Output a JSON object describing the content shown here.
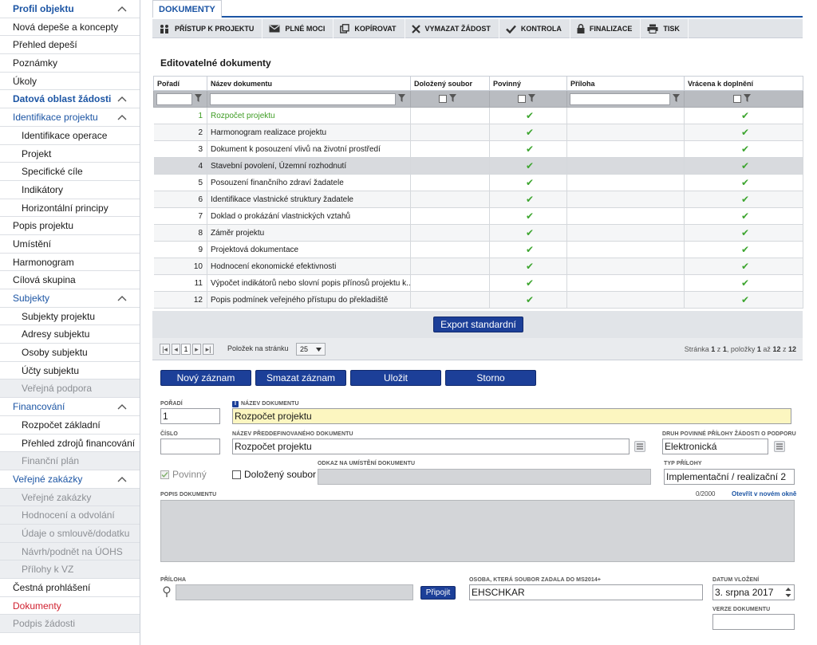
{
  "sidebar": {
    "items": [
      {
        "label": "Profil objektu",
        "kind": "sect"
      },
      {
        "label": "Nová depeše a koncepty",
        "kind": "item"
      },
      {
        "label": "Přehled depeší",
        "kind": "item"
      },
      {
        "label": "Poznámky",
        "kind": "item"
      },
      {
        "label": "Úkoly",
        "kind": "item"
      },
      {
        "label": "Datová oblast žádosti",
        "kind": "sect"
      },
      {
        "label": "Identifikace projektu",
        "kind": "selsect"
      },
      {
        "label": "Identifikace operace",
        "kind": "sub"
      },
      {
        "label": "Projekt",
        "kind": "sub"
      },
      {
        "label": "Specifické cíle",
        "kind": "sub"
      },
      {
        "label": "Indikátory",
        "kind": "sub"
      },
      {
        "label": "Horizontální principy",
        "kind": "sub"
      },
      {
        "label": "Popis projektu",
        "kind": "item"
      },
      {
        "label": "Umístění",
        "kind": "item"
      },
      {
        "label": "Harmonogram",
        "kind": "item"
      },
      {
        "label": "Cílová skupina",
        "kind": "item"
      },
      {
        "label": "Subjekty",
        "kind": "selsect"
      },
      {
        "label": "Subjekty projektu",
        "kind": "sub"
      },
      {
        "label": "Adresy subjektu",
        "kind": "sub"
      },
      {
        "label": "Osoby subjektu",
        "kind": "sub"
      },
      {
        "label": "Účty subjektu",
        "kind": "sub"
      },
      {
        "label": "Veřejná podpora",
        "kind": "subdis"
      },
      {
        "label": "Financování",
        "kind": "selsect"
      },
      {
        "label": "Rozpočet základní",
        "kind": "sub"
      },
      {
        "label": "Přehled zdrojů financování",
        "kind": "sub"
      },
      {
        "label": "Finanční plán",
        "kind": "subdis"
      },
      {
        "label": "Veřejné zakázky",
        "kind": "selsect"
      },
      {
        "label": "Veřejné zakázky",
        "kind": "subdis"
      },
      {
        "label": "Hodnocení a odvolání",
        "kind": "subdis"
      },
      {
        "label": "Údaje o smlouvě/dodatku",
        "kind": "subdis"
      },
      {
        "label": "Návrh/podnět na ÚOHS",
        "kind": "subdis"
      },
      {
        "label": "Přílohy k VZ",
        "kind": "subdis"
      },
      {
        "label": "Čestná prohlášení",
        "kind": "item"
      },
      {
        "label": "Dokumenty",
        "kind": "active"
      },
      {
        "label": "Podpis žádosti",
        "kind": "dis"
      }
    ]
  },
  "tab": {
    "label": "DOKUMENTY"
  },
  "toolbar": {
    "buttons": [
      {
        "label": "PŘÍSTUP K PROJEKTU",
        "icon": "people-icon"
      },
      {
        "label": "PLNÉ MOCI",
        "icon": "envelope-icon"
      },
      {
        "label": "KOPÍROVAT",
        "icon": "copy-icon"
      },
      {
        "label": "VYMAZAT ŽÁDOST",
        "icon": "x-icon"
      },
      {
        "label": "KONTROLA",
        "icon": "check-icon"
      },
      {
        "label": "FINALIZACE",
        "icon": "lock-icon"
      },
      {
        "label": "TISK",
        "icon": "printer-icon"
      }
    ]
  },
  "grid": {
    "title": "Editovatelné dokumenty",
    "columns": [
      "Pořadí",
      "Název dokumentu",
      "Doložený soubor",
      "Povinný",
      "Příloha",
      "Vrácena k doplnění"
    ],
    "check_glyph": "✔",
    "rows": [
      {
        "n": "1",
        "name": "Rozpočet projektu"
      },
      {
        "n": "2",
        "name": "Harmonogram realizace projektu"
      },
      {
        "n": "3",
        "name": "Dokument k posouzení vlivů na životní prostředí"
      },
      {
        "n": "4",
        "name": "Stavební povolení, Územní rozhodnutí"
      },
      {
        "n": "5",
        "name": "Posouzení finančního zdraví žadatele"
      },
      {
        "n": "6",
        "name": "Identifikace vlastnické struktury žadatele"
      },
      {
        "n": "7",
        "name": "Doklad o prokázání vlastnických vztahů"
      },
      {
        "n": "8",
        "name": "Záměr projektu"
      },
      {
        "n": "9",
        "name": "Projektová dokumentace"
      },
      {
        "n": "10",
        "name": "Hodnocení ekonomické efektivnosti"
      },
      {
        "n": "11",
        "name": "Výpočet indikátorů nebo slovní popis přínosů projektu k..."
      },
      {
        "n": "12",
        "name": "Popis podmínek veřejného přístupu do překladiště"
      }
    ]
  },
  "export": {
    "label": "Export standardní"
  },
  "pager": {
    "page": "1",
    "per_page_label": "Položek na stránku",
    "per_page": "25",
    "info_prefix": "Stránka",
    "page_of_a": "1",
    "of": "z",
    "page_of_b": "1",
    "items_prefix": ", položky",
    "from": "1",
    "to_word": "až",
    "to": "12",
    "total": "12"
  },
  "actions": {
    "new": "Nový záznam",
    "delete": "Smazat záznam",
    "save": "Uložit",
    "cancel": "Storno"
  },
  "form": {
    "poradi_label": "POŘADÍ",
    "poradi": "1",
    "nazev_label": "NÁZEV DOKUMENTU",
    "nazev": "Rozpočet projektu",
    "cislo_label": "ČÍSLO",
    "cislo": "",
    "predef_label": "NÁZEV PŘEDDEFINOVANÉHO DOKUMENTU",
    "predef": "Rozpočet projektu",
    "druh_label": "DRUH POVINNÉ PŘÍLOHY ŽÁDOSTI O PODPORU",
    "druh": "Elektronická",
    "povinny_label": "Povinný",
    "dolozeny_label": "Doložený soubor",
    "odkaz_label": "ODKAZ NA UMÍSTĚNÍ DOKUMENTU",
    "typ_label": "TYP PŘÍLOHY",
    "typ": "Implementační / realizační 2",
    "popis_label": "POPIS DOKUMENTU",
    "popis_count": "0/2000",
    "popis_link": "Otevřít v novém okně",
    "priloha_label": "PŘÍLOHA",
    "pripojit": "Připojit",
    "osoba_label": "OSOBA, KTERÁ SOUBOR ZADALA DO MS2014+",
    "osoba": "EHSCHKAR",
    "datum_label": "DATUM VLOŽENÍ",
    "datum": "3. srpna 2017",
    "verze_label": "VERZE DOKUMENTU",
    "verze": ""
  }
}
